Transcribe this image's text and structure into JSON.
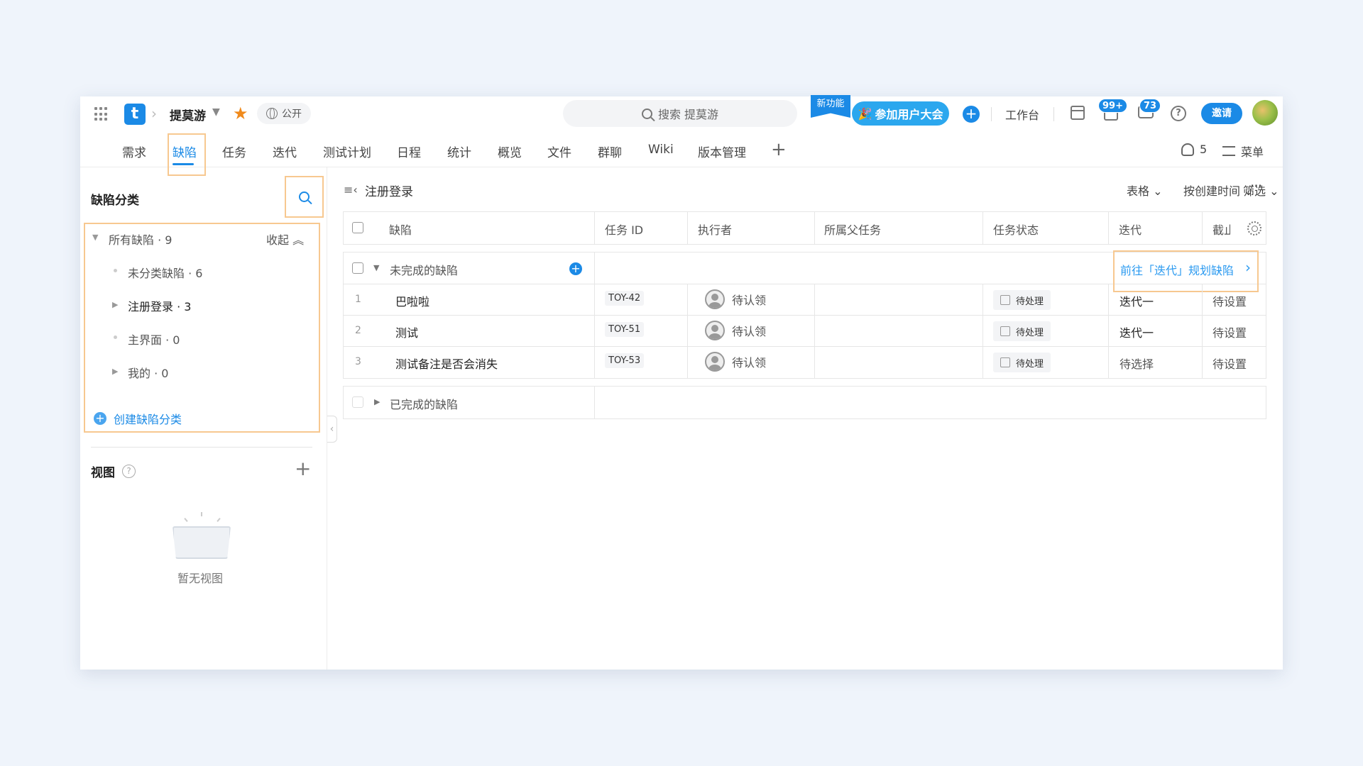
{
  "header": {
    "project_name": "提莫游",
    "visibility": "公开",
    "search_placeholder": "搜索 提莫游",
    "new_feature": "新功能",
    "event_button": "参加用户大会",
    "workbench": "工作台",
    "notifications_badge": "99+",
    "messages_badge": "73",
    "invite": "邀请",
    "logo_letter": "t"
  },
  "tabs": [
    "需求",
    "缺陷",
    "任务",
    "迭代",
    "测试计划",
    "日程",
    "统计",
    "概览",
    "文件",
    "群聊",
    "Wiki",
    "版本管理"
  ],
  "active_tab": "缺陷",
  "members_count": "5",
  "menu_label": "菜单",
  "sidebar": {
    "title": "缺陷分类",
    "all": "所有缺陷 · 9",
    "collapse": "收起",
    "categories": [
      {
        "label": "未分类缺陷 · 6"
      },
      {
        "label": "注册登录 · 3"
      },
      {
        "label": "主界面 · 0"
      },
      {
        "label": "我的 · 0"
      }
    ],
    "create": "创建缺陷分类",
    "views_title": "视图",
    "empty_views": "暂无视图"
  },
  "main": {
    "title": "注册登录",
    "view_mode": "表格",
    "sort": "按创建时间",
    "filter": "筛选",
    "columns": [
      "缺陷",
      "任务 ID",
      "执行者",
      "所属父任务",
      "任务状态",
      "迭代",
      "截止"
    ],
    "incomplete_group": "未完成的缺陷",
    "goto_link": "前往「迭代」规划缺陷",
    "complete_group": "已完成的缺陷",
    "rows": [
      {
        "idx": "1",
        "title": "巴啦啦",
        "id": "TOY-42",
        "assignee": "待认领",
        "status": "待处理",
        "iteration": "迭代一",
        "due": "待设置"
      },
      {
        "idx": "2",
        "title": "测试",
        "id": "TOY-51",
        "assignee": "待认领",
        "status": "待处理",
        "iteration": "迭代一",
        "due": "待设置"
      },
      {
        "idx": "3",
        "title": "测试备注是否会消失",
        "id": "TOY-53",
        "assignee": "待认领",
        "status": "待处理",
        "iteration": "待选择",
        "due": "待设置"
      }
    ]
  },
  "colors": {
    "accent": "#1b8ae6",
    "highlight": "#f7c890",
    "star": "#f08a1c"
  }
}
